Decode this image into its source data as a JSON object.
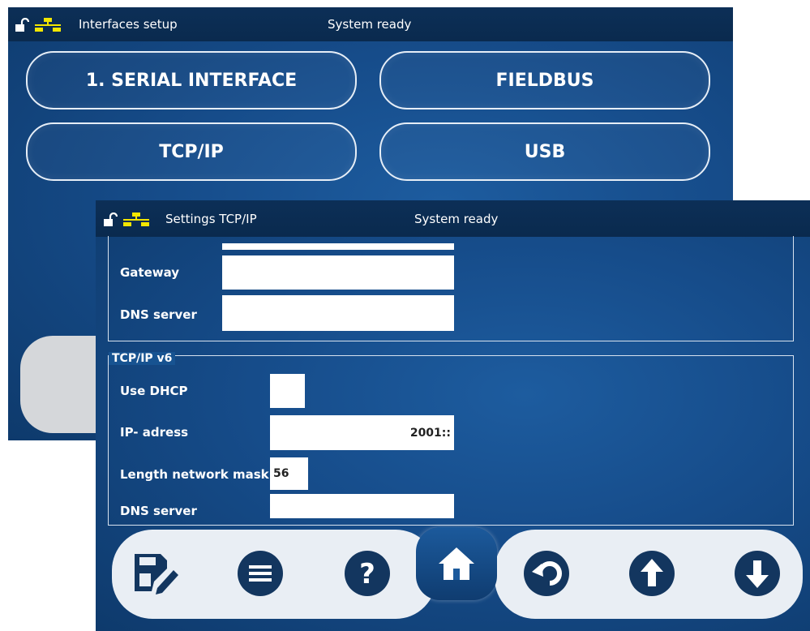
{
  "back_window": {
    "title": "Interfaces setup",
    "status": "System ready",
    "buttons": [
      "1. SERIAL INTERFACE",
      "FIELDBUS",
      "TCP/IP",
      "USB"
    ]
  },
  "front_window": {
    "title": "Settings TCP/IP",
    "status": "System ready",
    "v4_fields": [
      {
        "label": "Gateway",
        "value": ""
      },
      {
        "label": "DNS server",
        "value": ""
      }
    ],
    "v6_group_title": "TCP/IP v6",
    "v6_fields": {
      "use_dhcp": {
        "label": "Use DHCP",
        "checked": false
      },
      "ip_address": {
        "label": "IP- adress",
        "value": "2001::"
      },
      "mask": {
        "label": "Length network mask",
        "value": "56"
      },
      "dns": {
        "label": "DNS server",
        "value": ""
      }
    }
  },
  "toolbar": {
    "icons": [
      "save-icon",
      "menu-icon",
      "help-icon",
      "home-icon",
      "undo-icon",
      "arrow-up-icon",
      "arrow-down-icon"
    ]
  },
  "colors": {
    "panel_blue": "#1a5694",
    "topbar": "#0c2f57",
    "network_icon": "#f2e600",
    "toolbar_bg": "#e9eef4",
    "icon_navy": "#13365f"
  }
}
